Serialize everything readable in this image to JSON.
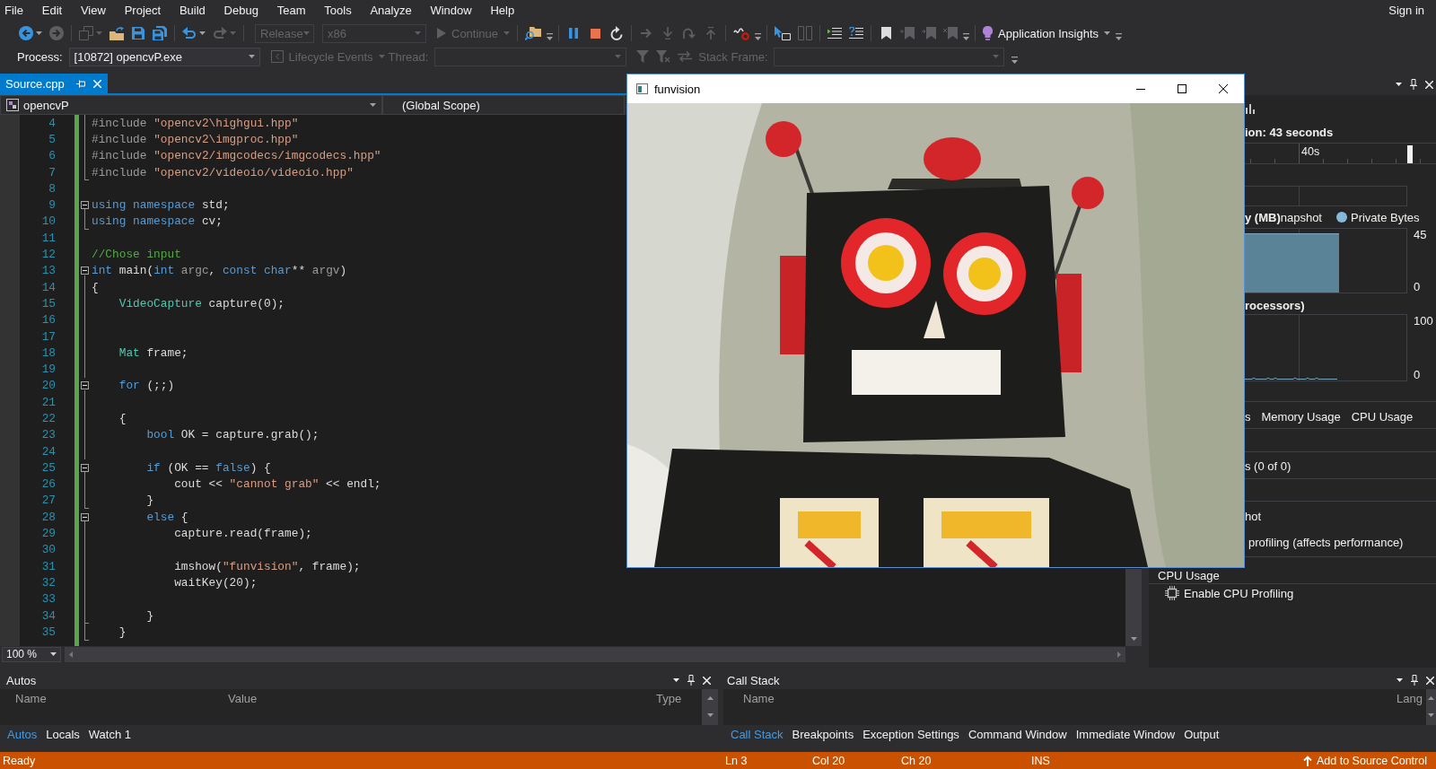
{
  "menu": {
    "items": [
      "File",
      "Edit",
      "View",
      "Project",
      "Build",
      "Debug",
      "Team",
      "Tools",
      "Analyze",
      "Window",
      "Help"
    ],
    "sign_in": "Sign in"
  },
  "toolbar": [
    [
      {
        "kind": "icon",
        "disabled": false
      },
      {
        "kind": "icon",
        "disabled": true
      }
    ],
    [
      {
        "kind": "icon",
        "disabled": true
      },
      {
        "kind": "icon",
        "disabled": false
      },
      {
        "kind": "icon",
        "disabled": false
      },
      {
        "kind": "icon",
        "disabled": false
      }
    ],
    [
      {
        "kind": "icon",
        "disabled": false
      },
      {
        "kind": "icon",
        "disabled": true
      }
    ],
    [
      {
        "kind": "combo",
        "value": "Release",
        "disabled": true
      },
      {
        "kind": "combo",
        "value": "x86",
        "disabled": true
      },
      {
        "kind": "command",
        "label": "Continue",
        "disabled": true
      }
    ],
    [
      {
        "kind": "icon",
        "disabled": false
      }
    ],
    [
      {
        "kind": "icon",
        "disabled": false
      },
      {
        "kind": "icon",
        "disabled": false
      },
      {
        "kind": "icon",
        "disabled": false
      }
    ],
    [
      {
        "kind": "icon",
        "disabled": true
      },
      {
        "kind": "icon",
        "disabled": true
      },
      {
        "kind": "icon",
        "disabled": true
      },
      {
        "kind": "icon",
        "disabled": true
      }
    ],
    [
      {
        "kind": "icon",
        "disabled": false
      }
    ],
    [
      {
        "kind": "icon",
        "disabled": false
      },
      {
        "kind": "icon",
        "disabled": true
      }
    ],
    [
      {
        "kind": "icon",
        "disabled": false
      },
      {
        "kind": "icon",
        "disabled": false
      }
    ],
    [
      {
        "kind": "icon",
        "disabled": false
      },
      {
        "kind": "icon",
        "disabled": true
      },
      {
        "kind": "icon",
        "disabled": true
      },
      {
        "kind": "icon",
        "disabled": true
      }
    ],
    [
      {
        "kind": "command",
        "label": "Application Insights",
        "disabled": false
      }
    ]
  ],
  "debug_location": {
    "process_label": "Process:",
    "process": "[10872] opencvP.exe",
    "lifecycle": {
      "label": "Lifecycle Events",
      "disabled": true
    },
    "thread_label": "Thread:",
    "thread_disabled": true,
    "filters": [
      {
        "disabled": true
      },
      {
        "disabled": true
      },
      {
        "disabled": true
      }
    ],
    "stack_frame_label": "Stack Frame:",
    "stack_frame_disabled": true
  },
  "document_tabs": [
    {
      "label": "Source.cpp",
      "selected": true
    }
  ],
  "navigation": {
    "project": "opencvP",
    "scope": "(Global Scope)"
  },
  "editor": {
    "changes_marked": true,
    "lines": [
      {
        "number": "4",
        "fold_guide": true,
        "tokens": [
          {
            "kind": "preproc",
            "text": "#include "
          },
          {
            "kind": "string",
            "text": "\"opencv2\\highgui.hpp\""
          }
        ]
      },
      {
        "number": "5",
        "fold_guide": true,
        "tokens": [
          {
            "kind": "preproc",
            "text": "#include "
          },
          {
            "kind": "string",
            "text": "\"opencv2\\imgproc.hpp\""
          }
        ]
      },
      {
        "number": "6",
        "fold_guide": true,
        "tokens": [
          {
            "kind": "preproc",
            "text": "#include "
          },
          {
            "kind": "string",
            "text": "\"opencv2/imgcodecs/imgcodecs.hpp\""
          }
        ]
      },
      {
        "number": "7",
        "fold_end": true,
        "tokens": [
          {
            "kind": "preproc",
            "text": "#include "
          },
          {
            "kind": "string",
            "text": "\"opencv2/videoio/videoio.hpp\""
          }
        ]
      },
      {
        "number": "8"
      },
      {
        "number": "9",
        "fold_start": true,
        "tokens": [
          {
            "kind": "keyword",
            "text": "using namespace"
          },
          {
            "kind": "plain",
            "text": " std;"
          }
        ]
      },
      {
        "number": "10",
        "fold_end": true,
        "tokens": [
          {
            "kind": "keyword",
            "text": "using namespace"
          },
          {
            "kind": "plain",
            "text": " cv;"
          }
        ]
      },
      {
        "number": "11"
      },
      {
        "number": "12",
        "tokens": [
          {
            "kind": "comment",
            "text": "//Chose input"
          }
        ]
      },
      {
        "number": "13",
        "fold_start": true,
        "tokens": [
          {
            "kind": "keyword",
            "text": "int"
          },
          {
            "kind": "plain",
            "text": " main("
          },
          {
            "kind": "keyword",
            "text": "int"
          },
          {
            "kind": "param",
            "text": " argc"
          },
          {
            "kind": "plain",
            "text": ", "
          },
          {
            "kind": "keyword",
            "text": "const char"
          },
          {
            "kind": "plain",
            "text": "** "
          },
          {
            "kind": "param",
            "text": "argv"
          },
          {
            "kind": "plain",
            "text": ")"
          }
        ]
      },
      {
        "number": "14",
        "fold_guide": true,
        "tokens": [
          {
            "kind": "plain",
            "text": "{"
          }
        ]
      },
      {
        "number": "15",
        "fold_guide": true,
        "tokens": [
          {
            "kind": "type",
            "text": "    VideoCapture"
          },
          {
            "kind": "plain",
            "text": " capture(0);"
          }
        ]
      },
      {
        "number": "16",
        "fold_guide": true
      },
      {
        "number": "17",
        "fold_guide": true
      },
      {
        "number": "18",
        "fold_guide": true,
        "tokens": [
          {
            "kind": "type",
            "text": "    Mat"
          },
          {
            "kind": "plain",
            "text": " frame;"
          }
        ]
      },
      {
        "number": "19",
        "fold_guide": true
      },
      {
        "number": "20",
        "fold_start": true,
        "tokens": [
          {
            "kind": "keyword",
            "text": "    for"
          },
          {
            "kind": "plain",
            "text": " (;;)"
          }
        ]
      },
      {
        "number": "21",
        "fold_guide": true
      },
      {
        "number": "22",
        "fold_guide": true,
        "tokens": [
          {
            "kind": "plain",
            "text": "    {"
          }
        ]
      },
      {
        "number": "23",
        "fold_guide": true,
        "tokens": [
          {
            "kind": "keyword",
            "text": "        bool"
          },
          {
            "kind": "plain",
            "text": " OK = capture.grab();"
          }
        ]
      },
      {
        "number": "24",
        "fold_guide": true
      },
      {
        "number": "25",
        "fold_start": true,
        "tokens": [
          {
            "kind": "keyword",
            "text": "        if"
          },
          {
            "kind": "plain",
            "text": " (OK == "
          },
          {
            "kind": "keyword",
            "text": "false"
          },
          {
            "kind": "plain",
            "text": ") {"
          }
        ]
      },
      {
        "number": "26",
        "fold_guide": true,
        "tokens": [
          {
            "kind": "plain",
            "text": "            cout << "
          },
          {
            "kind": "string",
            "text": "\"cannot grab\""
          },
          {
            "kind": "plain",
            "text": " << endl;"
          }
        ]
      },
      {
        "number": "27",
        "fold_end": true,
        "tokens": [
          {
            "kind": "plain",
            "text": "        }"
          }
        ]
      },
      {
        "number": "28",
        "fold_start": true,
        "tokens": [
          {
            "kind": "keyword",
            "text": "        else"
          },
          {
            "kind": "plain",
            "text": " {"
          }
        ]
      },
      {
        "number": "29",
        "fold_guide": true,
        "tokens": [
          {
            "kind": "plain",
            "text": "            capture.read(frame);"
          }
        ]
      },
      {
        "number": "30",
        "fold_guide": true
      },
      {
        "number": "31",
        "fold_guide": true,
        "tokens": [
          {
            "kind": "plain",
            "text": "            imshow("
          },
          {
            "kind": "string",
            "text": "\"funvision\""
          },
          {
            "kind": "plain",
            "text": ", frame);"
          }
        ]
      },
      {
        "number": "32",
        "fold_guide": true,
        "tokens": [
          {
            "kind": "plain",
            "text": "            waitKey(20);"
          }
        ]
      },
      {
        "number": "33",
        "fold_guide": true
      },
      {
        "number": "34",
        "fold_end": true,
        "tokens": [
          {
            "kind": "plain",
            "text": "        }"
          }
        ]
      },
      {
        "number": "35",
        "fold_end": true,
        "tokens": [
          {
            "kind": "plain",
            "text": "    }"
          }
        ]
      }
    ],
    "zoom": "100 %"
  },
  "image_window": {
    "title": "funvision"
  },
  "diagnostics": {
    "session": "ion: 43 seconds",
    "ruler_label": "40s",
    "memory_title": "y (MB)",
    "snapshot_legend": "napshot",
    "series_legend": "Private Bytes",
    "memory_axis": [
      "45",
      "0"
    ],
    "cpu_title": "rocessors)",
    "cpu_axis": [
      "100",
      "0"
    ],
    "tabs": [
      {
        "label": "s",
        "selected": false
      },
      {
        "label": "Memory Usage",
        "selected": false
      },
      {
        "label": "CPU Usage",
        "selected": false
      }
    ],
    "events": "s (0 of 0)",
    "snapshot": "hot",
    "heap_profiling": "profiling (affects performance)",
    "cpu_section": "CPU Usage",
    "cpu_profiling": "Enable CPU Profiling"
  },
  "autos": {
    "title": "Autos",
    "columns": [
      "Name",
      "Value",
      "Type"
    ],
    "tabs": [
      {
        "label": "Autos",
        "selected": true
      },
      {
        "label": "Locals",
        "selected": false
      },
      {
        "label": "Watch 1",
        "selected": false
      }
    ]
  },
  "call_stack": {
    "title": "Call Stack",
    "columns": [
      "Name",
      "Lang"
    ],
    "tabs": [
      {
        "label": "Call Stack",
        "selected": true
      },
      {
        "label": "Breakpoints",
        "selected": false
      },
      {
        "label": "Exception Settings",
        "selected": false
      },
      {
        "label": "Command Window",
        "selected": false
      },
      {
        "label": "Immediate Window",
        "selected": false
      },
      {
        "label": "Output",
        "selected": false
      }
    ]
  },
  "status_bar": {
    "state": "Ready",
    "line": "Ln 3",
    "column": "Col 20",
    "character": "Ch 20",
    "mode": "INS",
    "source_control": "Add to Source Control"
  }
}
